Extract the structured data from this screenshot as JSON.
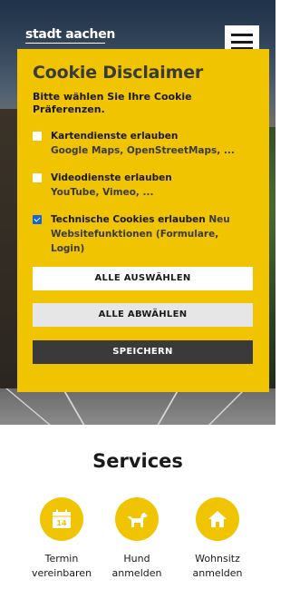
{
  "header": {
    "logo_text": "stadt aachen",
    "menu_icon": "hamburger-menu-icon"
  },
  "cookie": {
    "title": "Cookie Disclaimer",
    "subtitle": "Bitte wählen Sie Ihre Cookie Präferenzen.",
    "options": [
      {
        "label": "Kartendienste erlauben",
        "extra": "Google Maps, OpenStreetMaps, ...",
        "checked": false
      },
      {
        "label": "Videodienste erlauben",
        "extra": "YouTube, Vimeo, ...",
        "checked": false
      },
      {
        "label": "Technische Cookies erlauben",
        "neu": "Neu",
        "extra": "Websitefunktionen (Formulare, Login)",
        "checked": true
      }
    ],
    "select_all_label": "ALLE AUSWÄHLEN",
    "deselect_all_label": "ALLE ABWÄHLEN",
    "save_label": "SPEICHERN"
  },
  "services": {
    "title": "Services",
    "items": [
      {
        "line1": "Termin",
        "line2": "vereinbaren",
        "icon": "calendar-icon",
        "calendar_day": "14"
      },
      {
        "line1": "Hund",
        "line2": "anmelden",
        "icon": "dog-icon"
      },
      {
        "line1": "Wohnsitz",
        "line2": "anmelden",
        "icon": "house-icon"
      }
    ]
  },
  "colors": {
    "accent": "#f0c400",
    "checkbox_checked": "#1565d8",
    "save_button": "#3a3a3a"
  }
}
